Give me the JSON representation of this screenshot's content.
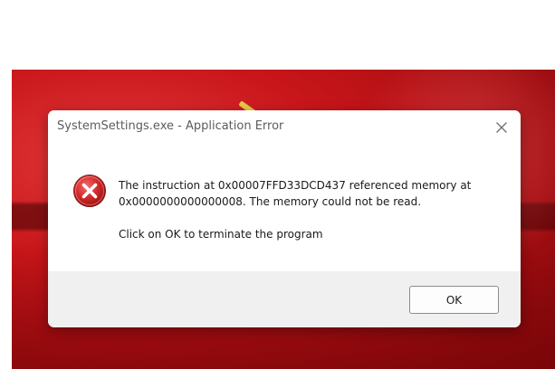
{
  "dialog": {
    "title": "SystemSettings.exe - Application Error",
    "icon": "error-icon",
    "close_icon": "close-icon",
    "message_line1": "The instruction at 0x00007FFD33DCD437 referenced memory at",
    "message_line2": "0x0000000000000008. The memory could not be read.",
    "hint": "Click on OK to terminate the program",
    "ok_label": "OK"
  },
  "colors": {
    "error_red": "#d42b2b",
    "footer_gray": "#f0f0f0",
    "desktop_red": "#c9161a"
  }
}
